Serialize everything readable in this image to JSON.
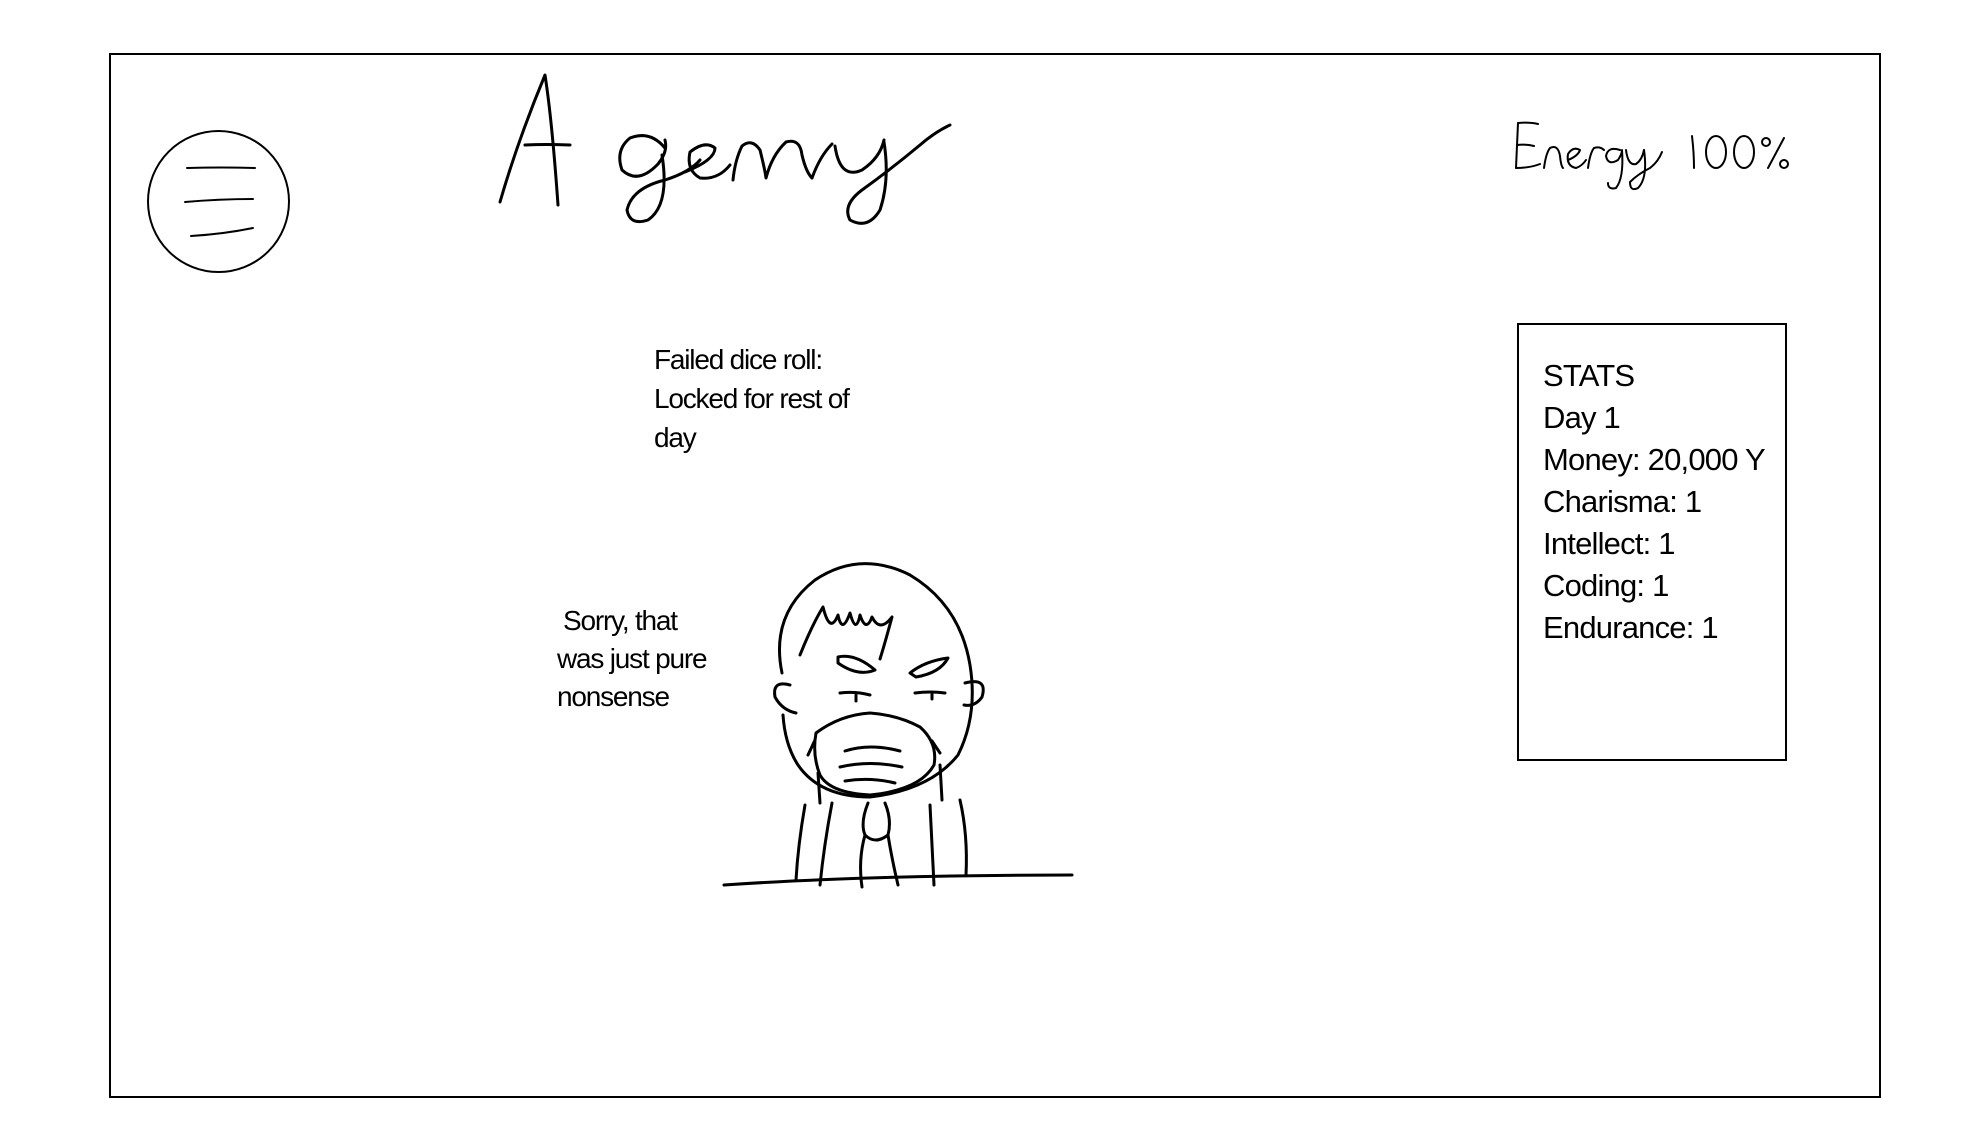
{
  "header": {
    "title": "Agency",
    "energy_label": "Energy",
    "energy_value": "100%",
    "menu_icon": "hamburger-menu-icon"
  },
  "notice": {
    "line1": "Failed dice roll:",
    "line2": "Locked for rest of",
    "line3": "day"
  },
  "dialogue": {
    "line1": "Sorry, that",
    "line2": "was just pure",
    "line3": "nonsense"
  },
  "character": {
    "icon": "masked-character-sketch"
  },
  "stats": {
    "heading": "STATS",
    "day": "Day 1",
    "money": "Money: 20,000 Y",
    "charisma": "Charisma: 1",
    "intellect": "Intellect: 1",
    "coding": "Coding: 1",
    "endurance": "Endurance: 1"
  }
}
